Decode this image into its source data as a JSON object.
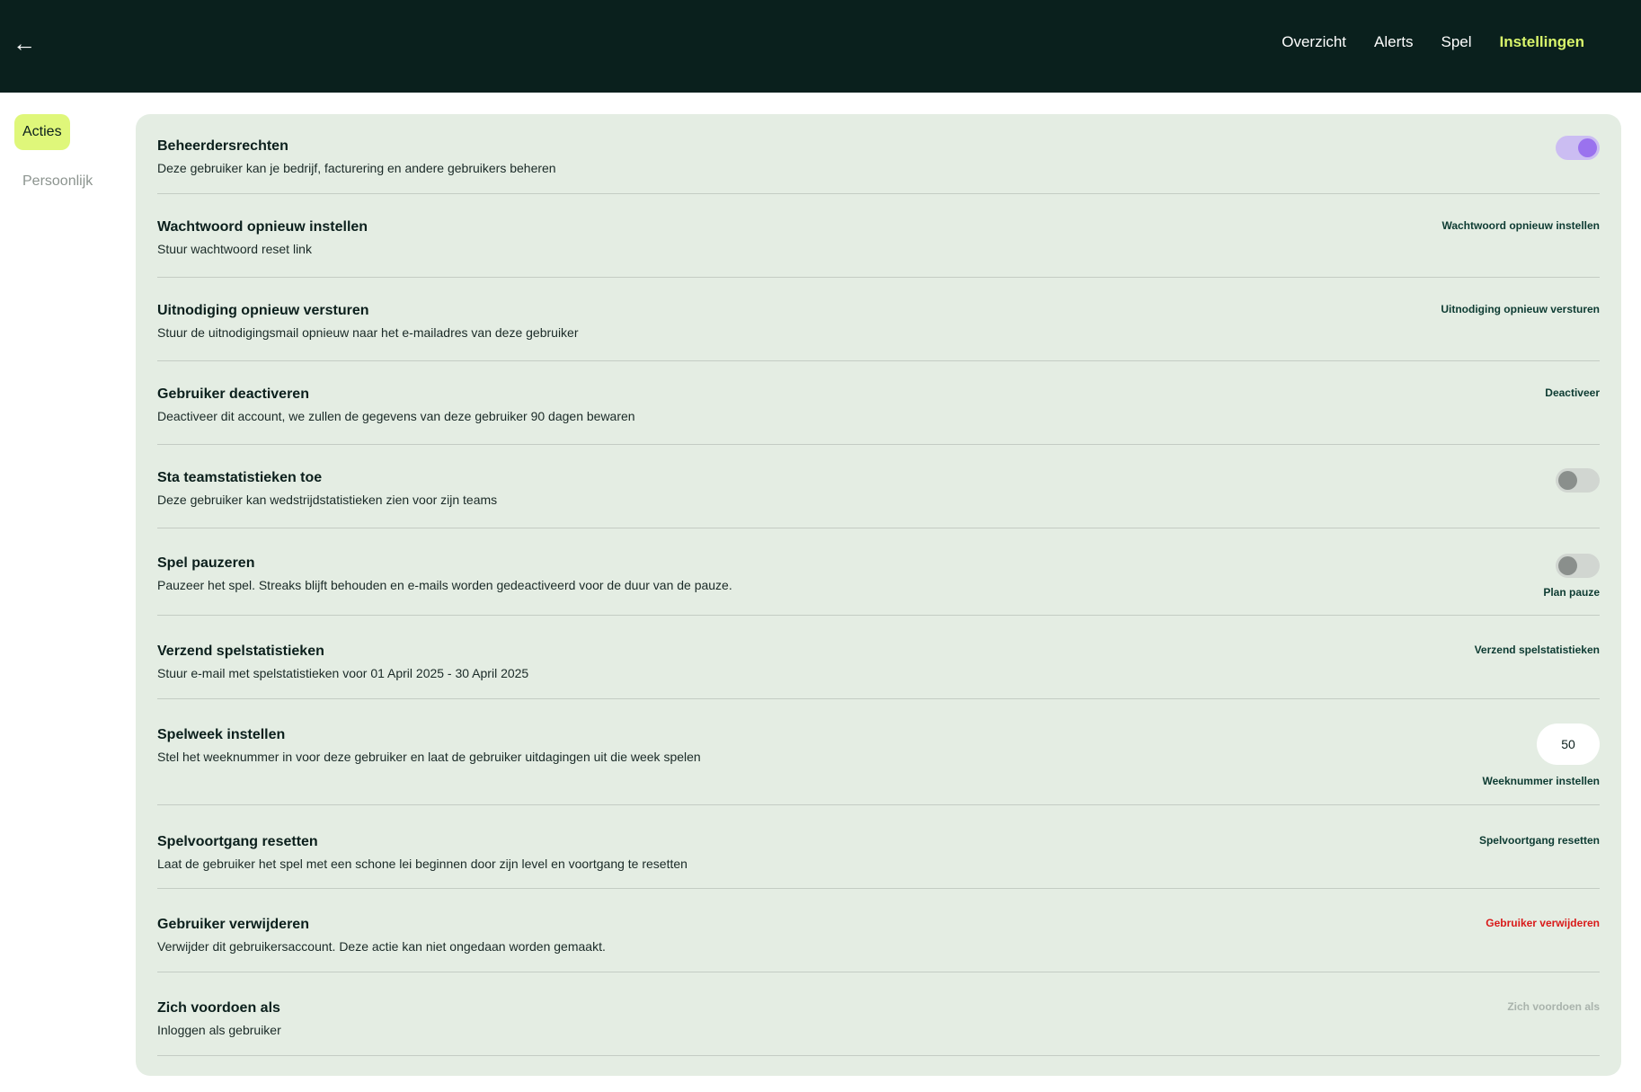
{
  "header": {
    "back_icon": "arrow-left-icon",
    "nav": [
      "Overzicht",
      "Alerts",
      "Spel",
      "Instellingen"
    ],
    "active_nav": "Instellingen"
  },
  "sidebar": {
    "items": [
      "Acties",
      "Persoonlijk"
    ],
    "active": "Acties"
  },
  "colors": {
    "accent": "#d9f56b",
    "topbar": "#0a201d",
    "panel": "#e4ede3",
    "toggle_on": "#9a72ee",
    "danger": "#d91a1a"
  },
  "settings": [
    {
      "title": "Beheerdersrechten",
      "desc": "Deze gebruiker kan je bedrijf, facturering en andere gebruikers beheren",
      "toggle": true
    },
    {
      "title": "Wachtwoord opnieuw instellen",
      "desc": "Stuur wachtwoord reset link",
      "action": "Wachtwoord opnieuw instellen"
    },
    {
      "title": "Uitnodiging opnieuw versturen",
      "desc": "Stuur de uitnodigingsmail opnieuw naar het e-mailadres van deze gebruiker",
      "action": "Uitnodiging opnieuw versturen"
    },
    {
      "title": "Gebruiker deactiveren",
      "desc": "Deactiveer dit account, we zullen de gegevens van deze gebruiker 90 dagen bewaren",
      "action": "Deactiveer"
    },
    {
      "title": "Sta teamstatistieken toe",
      "desc": "Deze gebruiker kan wedstrijdstatistieken zien voor zijn teams",
      "toggle": false
    },
    {
      "title": "Spel pauzeren",
      "desc": "Pauzeer het spel. Streaks blijft behouden en e-mails worden gedeactiveerd voor de duur van de pauze.",
      "toggle": false,
      "action": "Plan pauze"
    },
    {
      "title": "Verzend spelstatistieken",
      "desc": "Stuur e-mail met spelstatistieken voor 01 April 2025 - 30 April 2025",
      "action": "Verzend spelstatistieken"
    },
    {
      "title": "Spelweek instellen",
      "desc": "Stel het weeknummer in voor deze gebruiker en laat de gebruiker uitdagingen uit die week spelen",
      "input_value": "50",
      "action": "Weeknummer instellen"
    },
    {
      "title": "Spelvoortgang resetten",
      "desc": "Laat de gebruiker het spel met een schone lei beginnen door zijn level en voortgang te resetten",
      "action": "Spelvoortgang resetten"
    },
    {
      "title": "Gebruiker verwijderen",
      "desc": "Verwijder dit gebruikersaccount. Deze actie kan niet ongedaan worden gemaakt.",
      "action": "Gebruiker verwijderen",
      "action_style": "danger"
    },
    {
      "title": "Zich voordoen als",
      "desc": "Inloggen als gebruiker",
      "action": "Zich voordoen als",
      "action_style": "disabled"
    }
  ]
}
